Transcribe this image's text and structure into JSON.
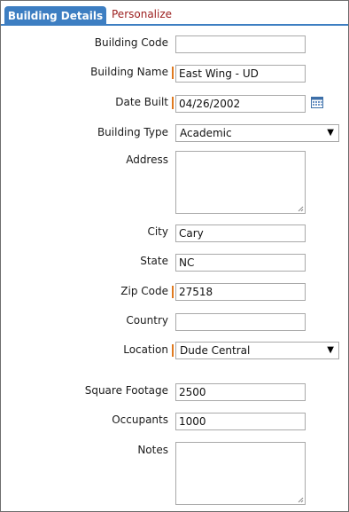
{
  "tabs": {
    "active": "Building Details",
    "inactive": "Personalize"
  },
  "form": {
    "building_code": {
      "label": "Building Code",
      "value": ""
    },
    "building_name": {
      "label": "Building Name",
      "value": "East Wing - UD",
      "required": true
    },
    "date_built": {
      "label": "Date Built",
      "value": "04/26/2002",
      "required": true,
      "icon": "calendar-icon"
    },
    "building_type": {
      "label": "Building Type",
      "value": "Academic"
    },
    "address": {
      "label": "Address",
      "value": ""
    },
    "city": {
      "label": "City",
      "value": "Cary"
    },
    "state": {
      "label": "State",
      "value": "NC"
    },
    "zip_code": {
      "label": "Zip Code",
      "value": "27518",
      "required": true
    },
    "country": {
      "label": "Country",
      "value": ""
    },
    "location": {
      "label": "Location",
      "value": "Dude Central",
      "required": true
    },
    "square_footage": {
      "label": "Square Footage",
      "value": "2500"
    },
    "occupants": {
      "label": "Occupants",
      "value": "1000"
    },
    "notes": {
      "label": "Notes",
      "value": ""
    }
  },
  "colors": {
    "tab_active_bg": "#3d7ec2",
    "tab_inactive_text": "#9b1c1c",
    "required_marker": "#e07a1f"
  }
}
